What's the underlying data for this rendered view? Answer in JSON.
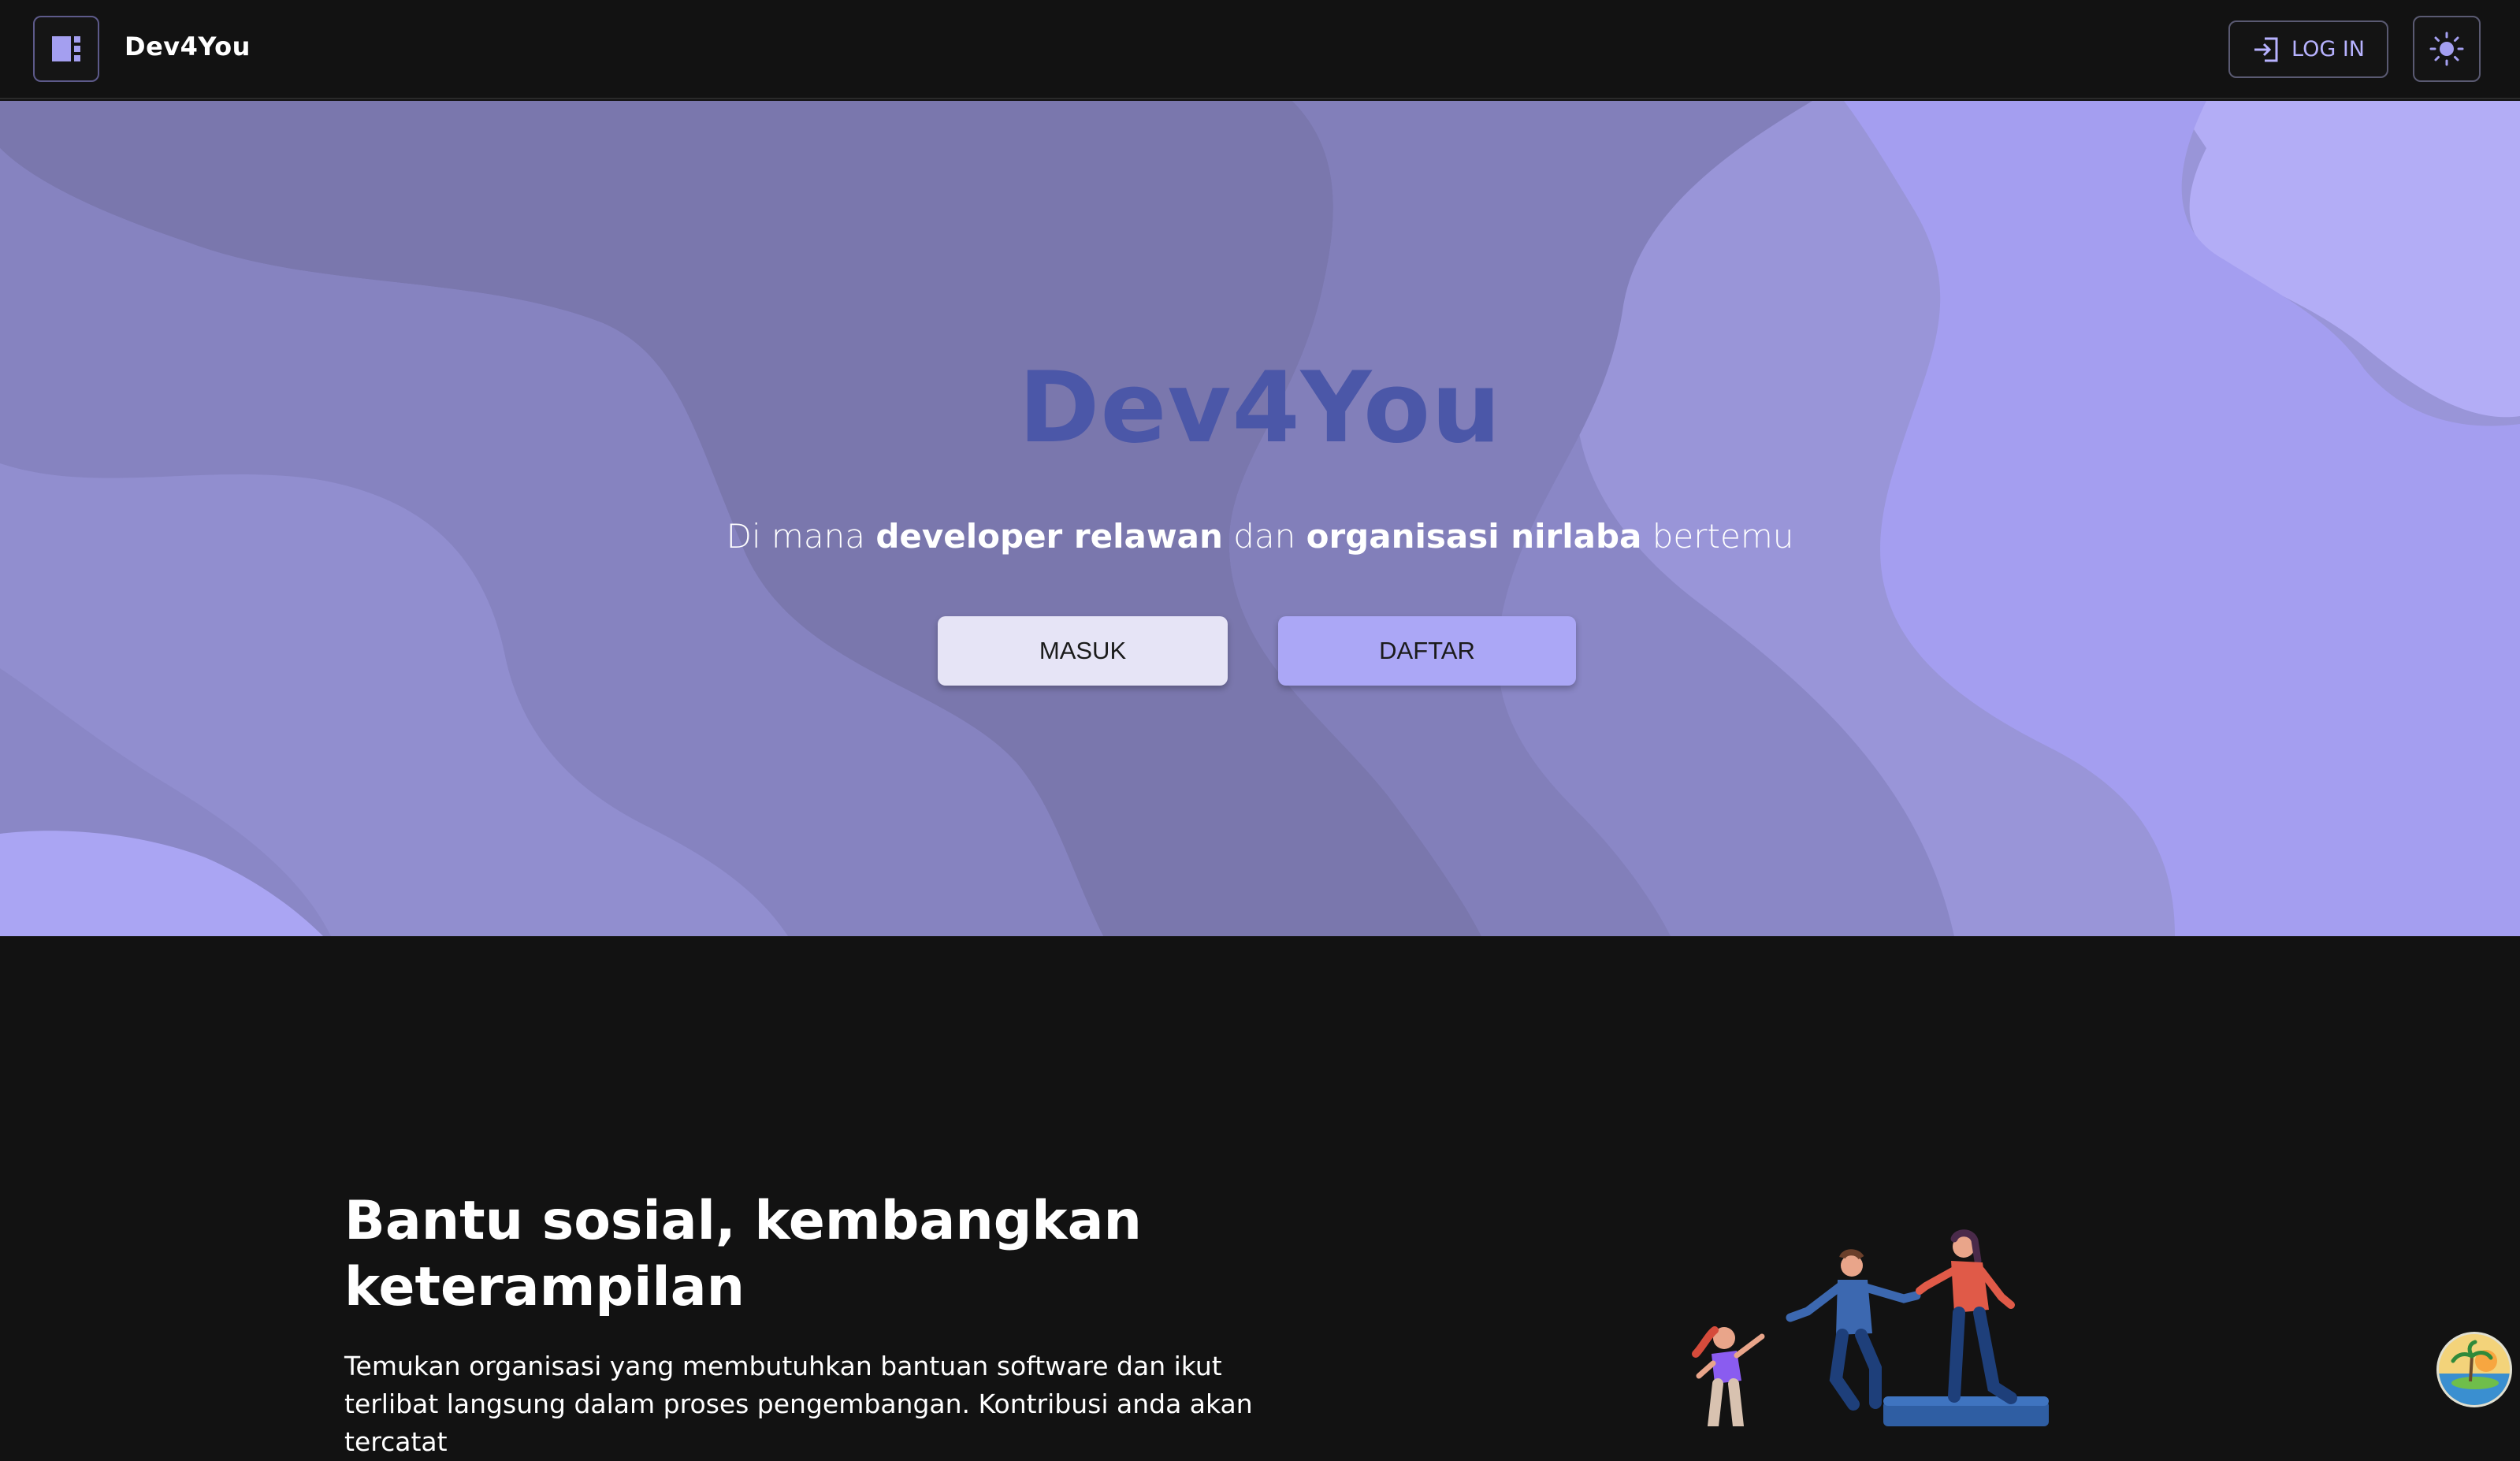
{
  "navbar": {
    "brand": "Dev4You",
    "login_label": "LOG IN",
    "icons": {
      "menu": "sidebar-menu-icon",
      "login": "login-icon",
      "theme": "sun-icon"
    }
  },
  "hero": {
    "title": "Dev4You",
    "subtitle_parts": {
      "p1": "Di mana ",
      "b1": "developer relawan",
      "p2": " dan ",
      "b2": "organisasi nirlaba",
      "p3": " bertemu"
    },
    "masuk_label": "MASUK",
    "daftar_label": "DAFTAR"
  },
  "section": {
    "title": "Bantu sosial, kembangkan keterampilan",
    "text": "Temukan organisasi yang membutuhkan bantuan software dan ikut terlibat langsung dalam proses pengembangan. Kontribusi anda akan tercatat"
  },
  "colors": {
    "background": "#121212",
    "accent": "#aba7f6",
    "hero_title": "#4b57a8",
    "wave_dark": "#7976ad",
    "wave_light": "#aba5f2"
  }
}
